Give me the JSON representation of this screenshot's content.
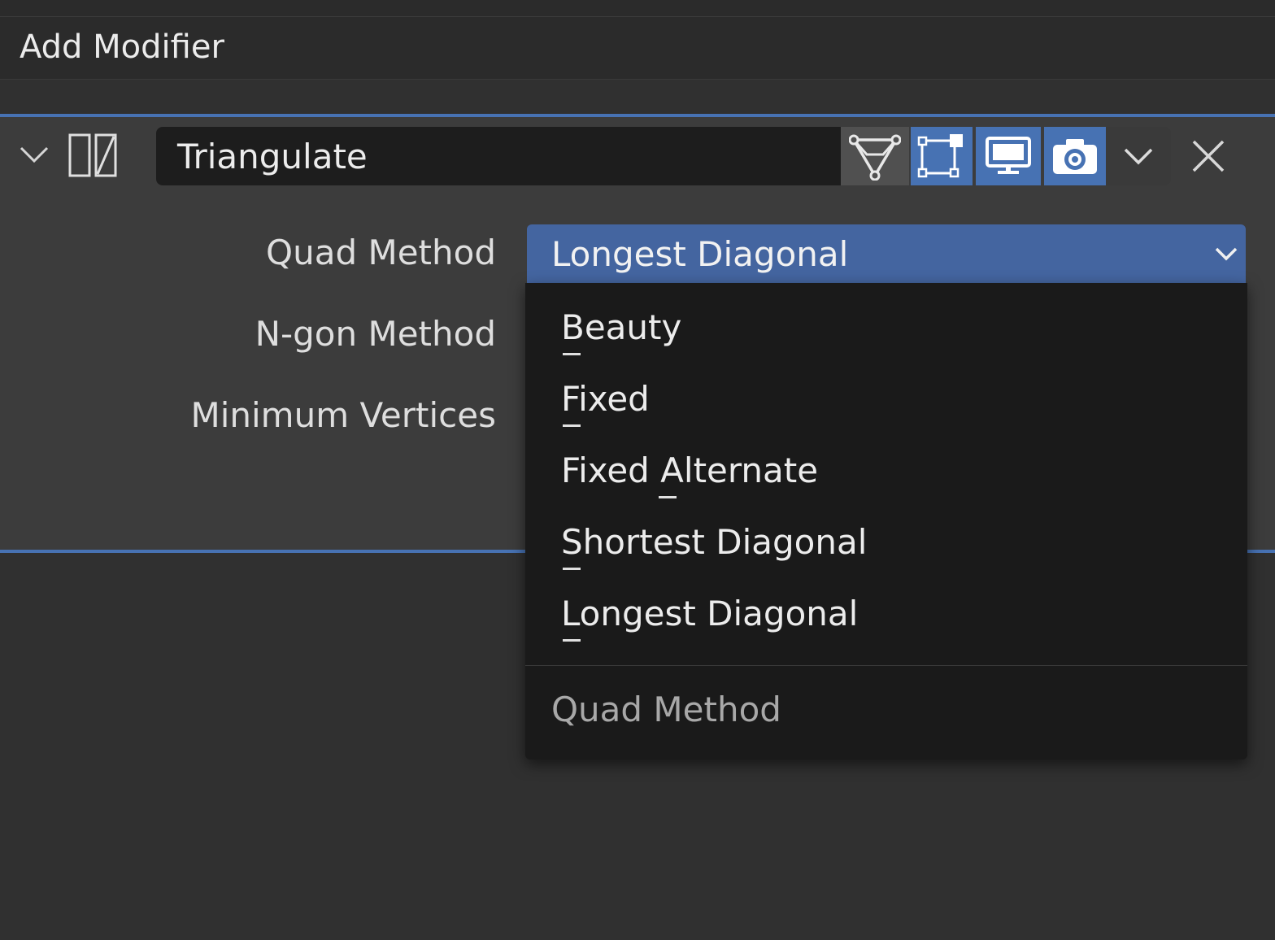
{
  "header": {
    "add_modifier_label": "Add Modifier"
  },
  "modifier": {
    "name": "Triangulate",
    "icons": {
      "collapse": "chevron-down-icon",
      "type": "triangulate-modifier-icon",
      "edit_mode": "edit-mode-icon",
      "on_cage": "on-cage-icon",
      "viewport": "monitor-icon",
      "render": "camera-icon",
      "menu": "chevron-down-icon",
      "close": "close-icon"
    },
    "toggle_states": {
      "edit_mode": false,
      "on_cage": true,
      "viewport": true,
      "render": true
    }
  },
  "properties": {
    "quad_method_label": "Quad Method",
    "ngon_method_label": "N-gon Method",
    "min_vertices_label": "Minimum Vertices",
    "quad_method_value": "Longest Diagonal"
  },
  "dropdown_menu": {
    "items": [
      "Beauty",
      "Fixed",
      "Fixed Alternate",
      "Shortest Diagonal",
      "Longest Diagonal"
    ],
    "title": "Quad Method"
  },
  "colors": {
    "accent": "#4772b3",
    "selected_field": "#4465a0",
    "panel_bg": "#3c3c3c",
    "menu_bg": "#1a1a1a"
  }
}
